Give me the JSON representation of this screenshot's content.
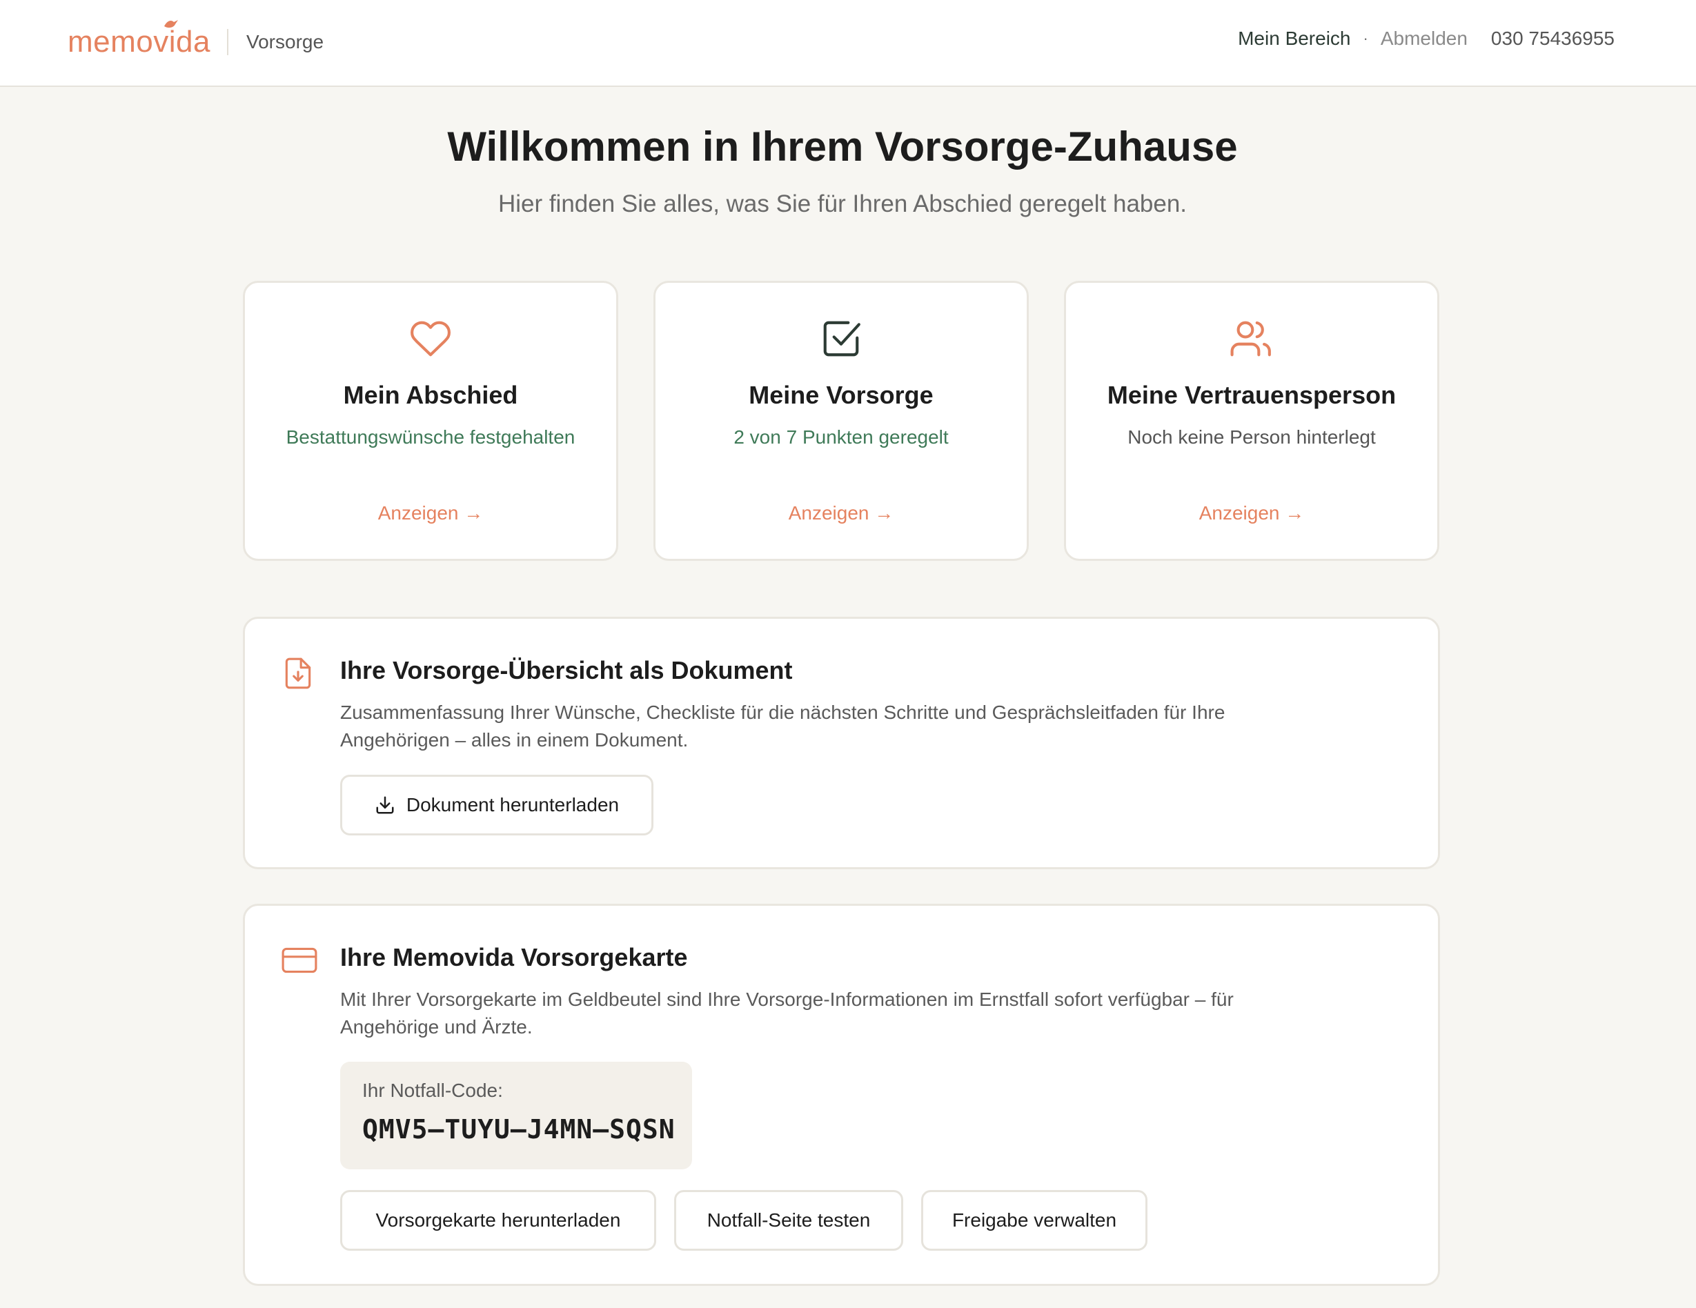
{
  "header": {
    "logo": "memovida",
    "section": "Vorsorge",
    "nav": {
      "mine": "Mein Bereich",
      "separator": "·",
      "logout": "Abmelden",
      "phone": "030 75436955"
    }
  },
  "hero": {
    "title": "Willkommen in Ihrem Vorsorge-Zuhause",
    "subtitle": "Hier finden Sie alles, was Sie für Ihren Abschied geregelt haben."
  },
  "tiles": [
    {
      "icon": "heart-icon",
      "title": "Mein Abschied",
      "status": "Bestattungswünsche festgehalten",
      "link": "Anzeigen →"
    },
    {
      "icon": "checkbox-icon",
      "title": "Meine Vorsorge",
      "status": "2 von 7 Punkten geregelt",
      "link": "Anzeigen →"
    },
    {
      "icon": "users-icon",
      "title": "Meine Vertrauensperson",
      "status": "Noch keine Person hinterlegt",
      "link": "Anzeigen →"
    }
  ],
  "document_panel": {
    "icon": "file-download-icon",
    "title": "Ihre Vorsorge-Übersicht als Dokument",
    "text": "Zusammenfassung Ihrer Wünsche, Checkliste für die nächsten Schritte und Gesprächsleitfaden für Ihre Angehörigen – alles in einem Dokument.",
    "button": "Dokument herunterladen"
  },
  "card_panel": {
    "icon": "credit-card-icon",
    "title": "Ihre Memovida Vorsorgekarte",
    "text": "Mit Ihrer Vorsorgekarte im Geldbeutel sind Ihre Vorsorge-Informationen im Ernstfall sofort verfügbar – für Angehörige und Ärzte.",
    "code_label": "Ihr Notfall-Code:",
    "code": "QMV5–TUYU–J4MN–SQSN",
    "buttons": [
      "Vorsorgekarte herunterladen",
      "Notfall-Seite testen",
      "Freigabe verwalten"
    ]
  },
  "colors": {
    "accent": "#e5825f",
    "status_green": "#3f7a58",
    "dark_icon": "#2c3b34",
    "background": "#f7f6f2",
    "border": "#e9e6df"
  }
}
